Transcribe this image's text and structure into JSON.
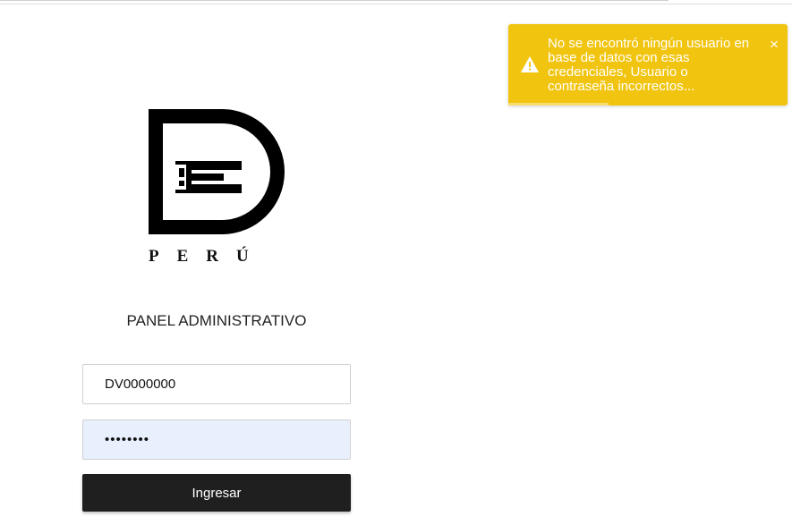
{
  "logo": {
    "caption": "PERÚ"
  },
  "login": {
    "title": "PANEL ADMINISTRATIVO",
    "username_value": "DV0000000",
    "password_value": "••••••••",
    "submit_label": "Ingresar"
  },
  "toast": {
    "type": "warning",
    "icon": "warning-icon",
    "message": "No se encontró ningún usuario en base de datos con esas credenciales, Usuario o contraseña incorrectos...",
    "close_label": "×",
    "color": "#f1c40f"
  },
  "colors": {
    "button_bg": "#1f1f1f",
    "autofill_bg": "#e8f0fe"
  }
}
